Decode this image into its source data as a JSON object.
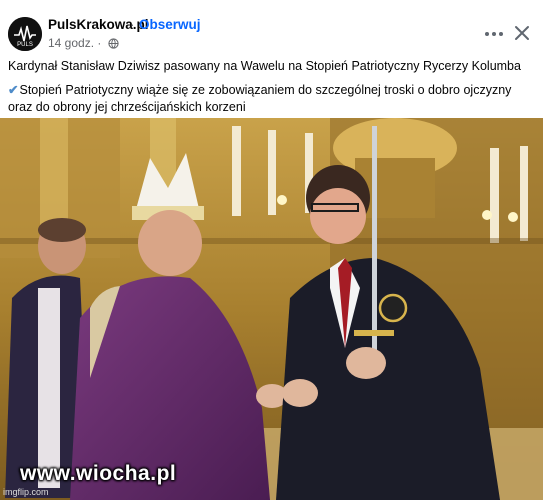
{
  "post": {
    "page_name": "PulsKrakowa.pl",
    "separator": "·",
    "follow_label": "Obserwuj",
    "time": "14 godz.",
    "time_separator": "·",
    "privacy_icon": "globe-icon",
    "text_line1": "Kardynał Stanisław Dziwisz pasowany na Wawelu na Stopień Patriotyczny Rycerzy Kolumba",
    "text_line2": "Stopień Patriotyczny wiąże się ze zobowiązaniem do szczególnej troski o dobro ojczyzny oraz do obrony jej chrześcijańskich korzeni",
    "check_icon": "check-mark-icon"
  },
  "avatar_text": "PULS",
  "photo": {
    "watermark": "www.wiocha.pl",
    "credit": "imgflip.com"
  },
  "colors": {
    "accent": "#0866ff",
    "muted": "#65676b",
    "text": "#050505"
  }
}
